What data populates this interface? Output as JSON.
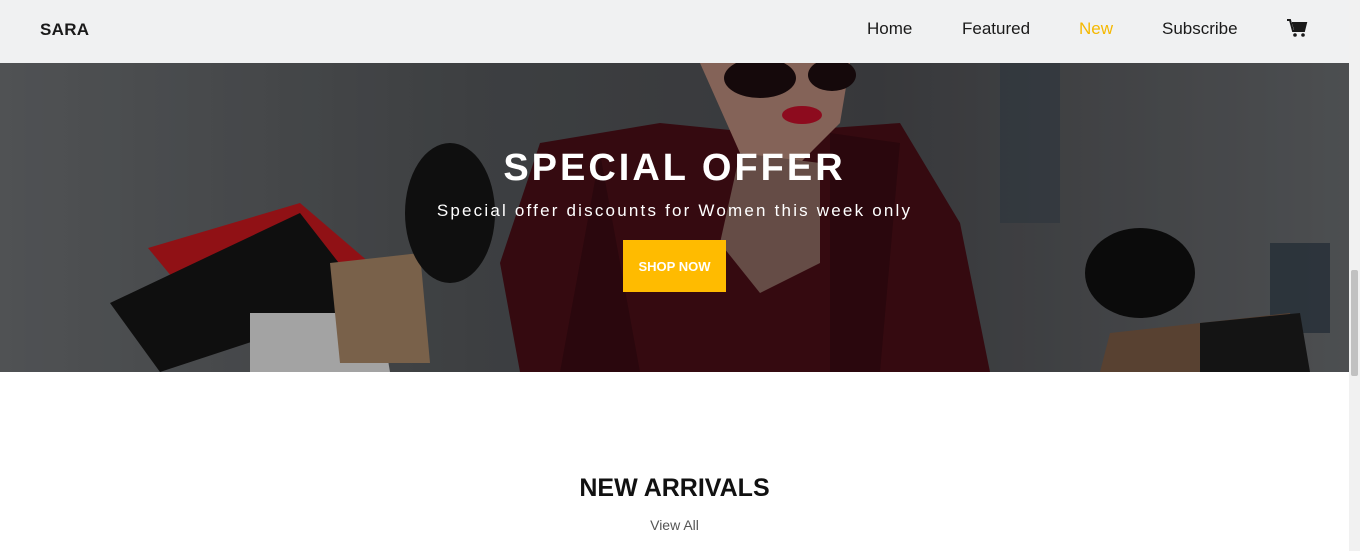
{
  "navbar": {
    "brand": "SARA",
    "links": [
      {
        "label": "Home",
        "active": false
      },
      {
        "label": "Featured",
        "active": false
      },
      {
        "label": "New",
        "active": true
      },
      {
        "label": "Subscribe",
        "active": false
      }
    ],
    "cart_icon": "shopping-cart-icon"
  },
  "hero": {
    "title": "SPECIAL OFFER",
    "subtitle": "Special offer discounts for Women this week only",
    "button_label": "SHOP NOW"
  },
  "new_arrivals": {
    "title": "NEW ARRIVALS",
    "view_all": "View All"
  },
  "colors": {
    "accent": "#ffbb00",
    "active_link": "#f5b800",
    "navbar_bg": "#f0f1f2"
  }
}
